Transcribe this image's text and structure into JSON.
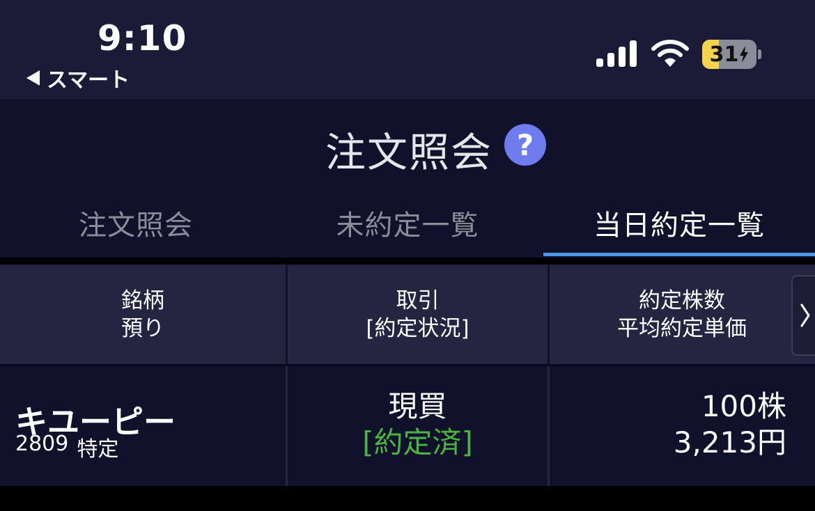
{
  "status_bar": {
    "time": "9:10",
    "back_label": "スマート",
    "battery_level": "31",
    "battery_fraction": 0.31,
    "signal_bars": 4,
    "colors": {
      "background": "#1a1c37",
      "battery_fill": "#f5d34a"
    }
  },
  "header": {
    "title": "注文照会",
    "help_icon": "?"
  },
  "tabs": [
    {
      "label": "注文照会",
      "active": false
    },
    {
      "label": "未約定一覧",
      "active": false
    },
    {
      "label": "当日約定一覧",
      "active": true
    }
  ],
  "table": {
    "columns": [
      {
        "line1": "銘柄",
        "line2": "預り"
      },
      {
        "line1": "取引",
        "line2": "[約定状況]"
      },
      {
        "line1": "約定株数",
        "line2": "平均約定単価"
      }
    ],
    "rows": [
      {
        "name": "キユーピー",
        "code": "2809",
        "account": "特定",
        "trade_type": "現買",
        "status": "[約定済]",
        "quantity": "100株",
        "avg_price": "3,213円"
      }
    ]
  },
  "icons": {
    "back": "back-triangle-icon",
    "signal": "cellular-signal-icon",
    "wifi": "wifi-icon",
    "battery": "battery-charging-icon",
    "help": "question-mark-icon",
    "scroll": "chevron-right-icon"
  },
  "colors": {
    "accent_tab_underline": "#4a95e4",
    "status_filled": "#4bb341",
    "help_icon_bg": "#6f7cf0",
    "header_bg": "#10112a",
    "table_header_bg": "#232541"
  }
}
